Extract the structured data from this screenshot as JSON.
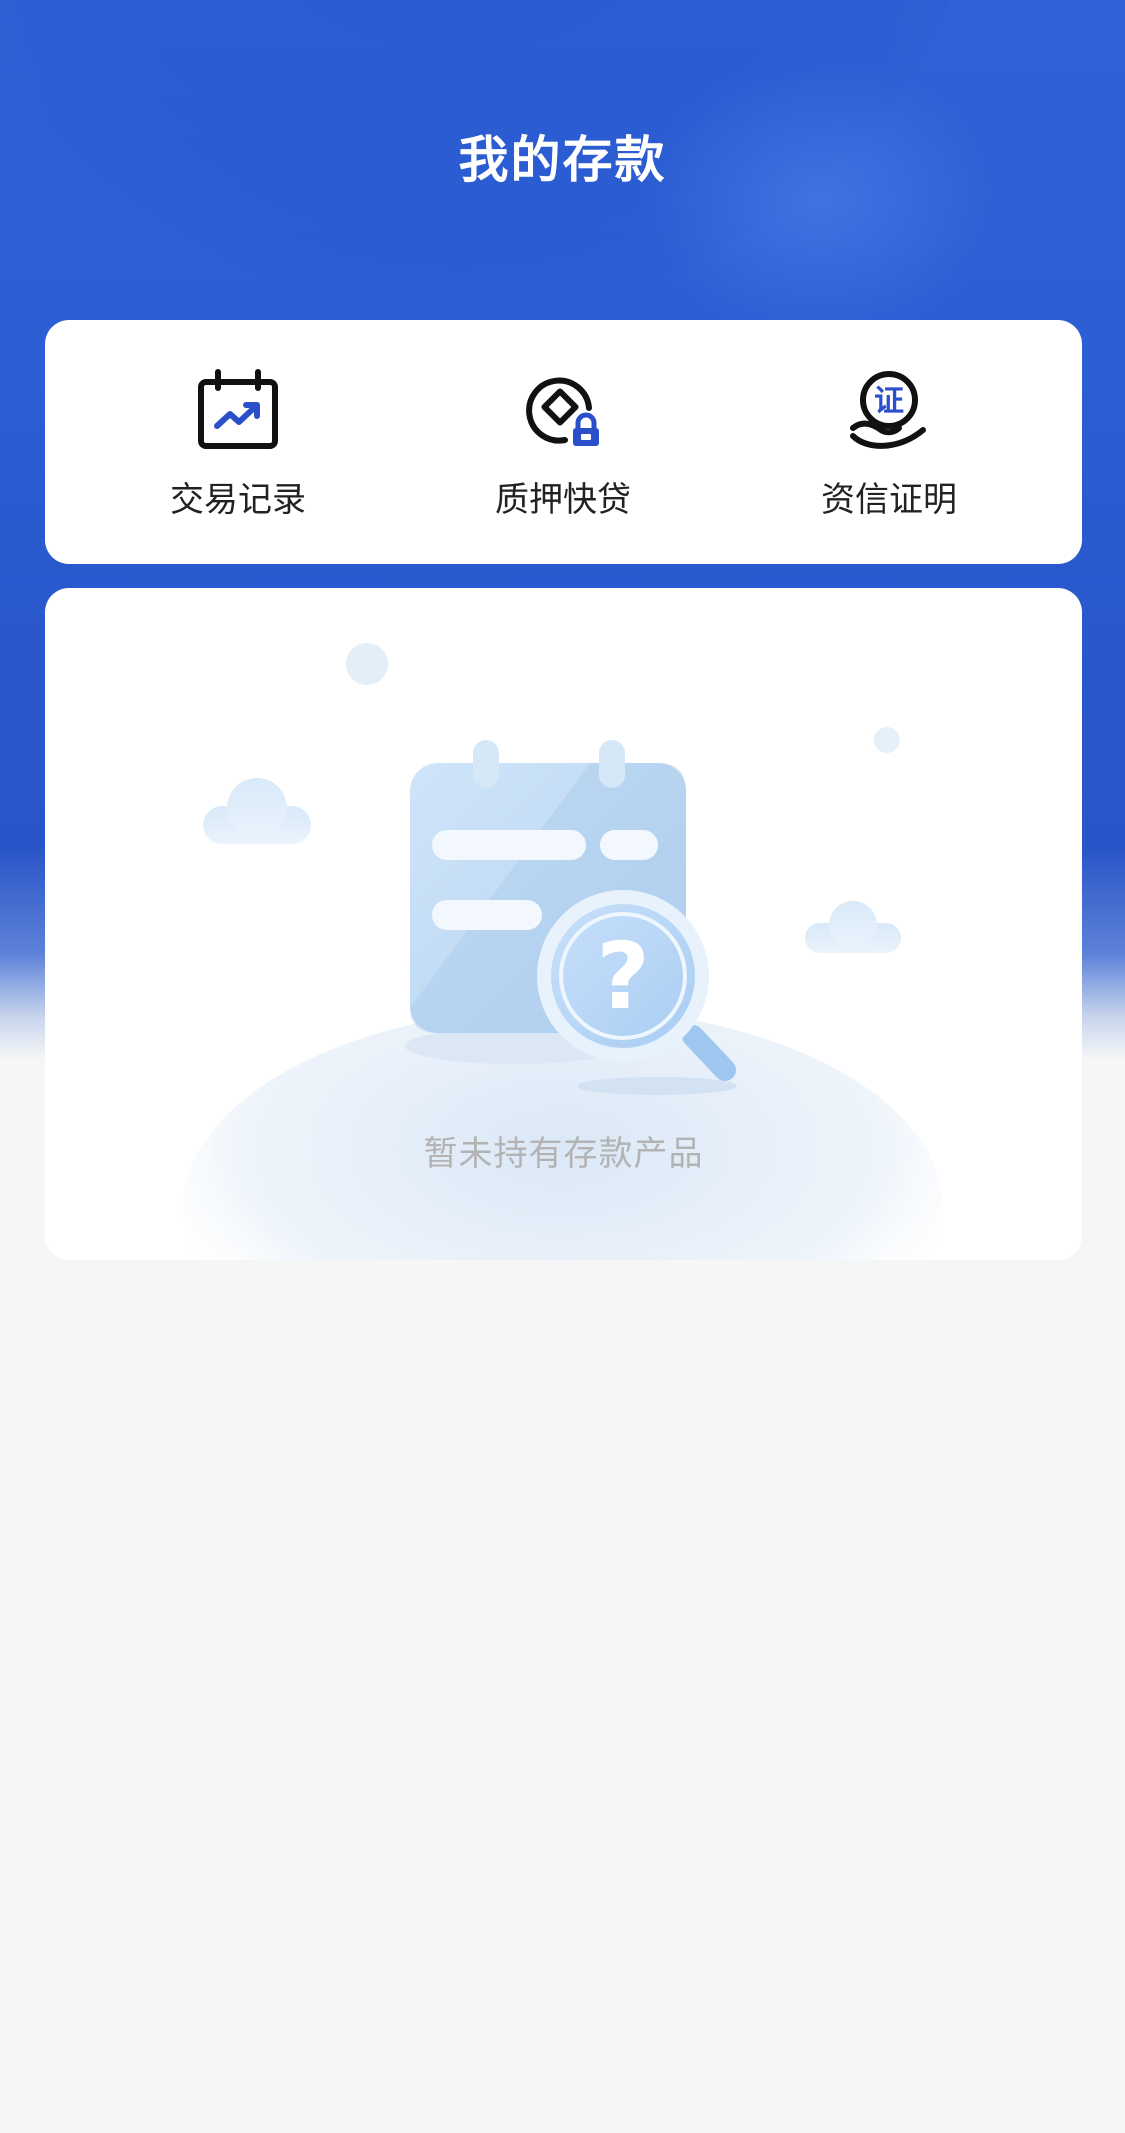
{
  "header": {
    "title": "我的存款"
  },
  "quick_actions": [
    {
      "label": "交易记录",
      "icon": "calendar-chart-icon"
    },
    {
      "label": "质押快贷",
      "icon": "pledge-loan-icon"
    },
    {
      "label": "资信证明",
      "icon": "credit-certificate-icon",
      "badge_text": "证"
    }
  ],
  "empty_state": {
    "message": "暂未持有存款产品",
    "illustration": "calendar-magnifier-question-illustration"
  },
  "colors": {
    "brand_blue": "#2c5ed4",
    "icon_accent": "#2a4fc9",
    "background": "#f5f6f6",
    "card": "#ffffff",
    "empty_text": "#b3b3b3"
  }
}
